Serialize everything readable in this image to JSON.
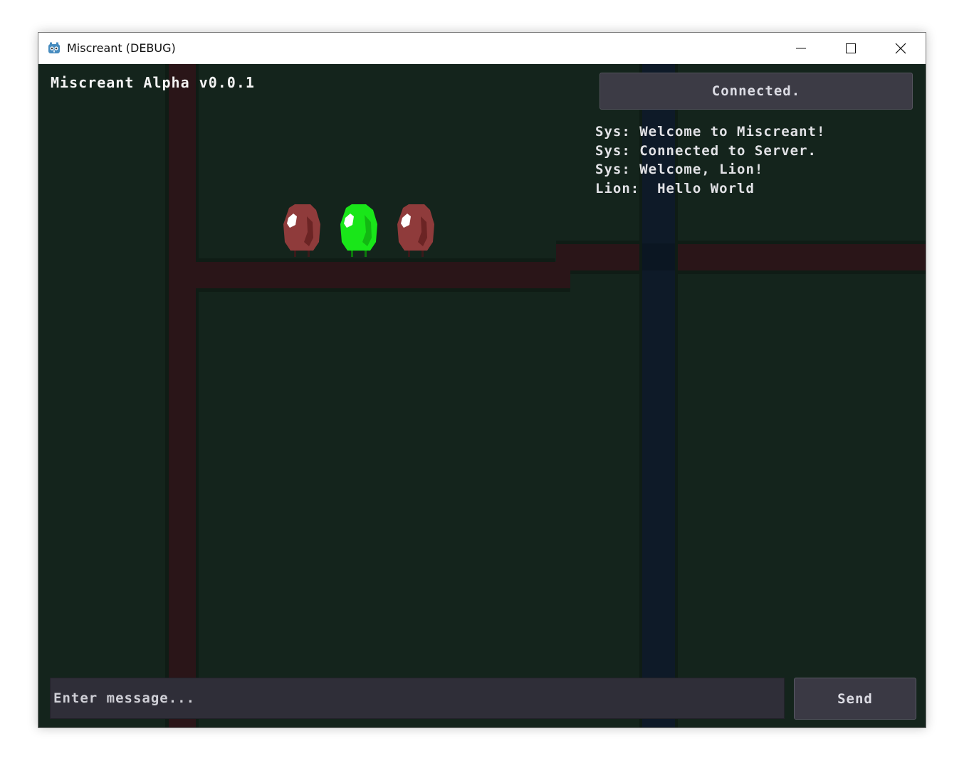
{
  "window": {
    "title": "Miscreant (DEBUG)",
    "app_icon": "godot-icon",
    "controls": {
      "minimize_icon": "minimize-icon",
      "maximize_icon": "maximize-icon",
      "close_icon": "close-icon"
    }
  },
  "hud": {
    "version_label": "Miscreant Alpha v0.0.1",
    "status_button_label": "Connected."
  },
  "chat": {
    "lines": [
      {
        "sender": "Sys:",
        "message": "Welcome to Miscreant!"
      },
      {
        "sender": "Sys:",
        "message": "Connected to Server."
      },
      {
        "sender": "Sys:",
        "message": "Welcome, Lion!"
      },
      {
        "sender": "Lion:",
        "message": " Hello World"
      }
    ],
    "input_placeholder": "Enter message...",
    "input_value": "",
    "send_label": "Send"
  },
  "players": [
    {
      "role": "remote-player",
      "color": "#8f3b3b"
    },
    {
      "role": "local-player",
      "color": "#19e619"
    },
    {
      "role": "remote-player",
      "color": "#8f3b3b"
    }
  ],
  "colors": {
    "background": "#14241c",
    "dirt": "#2a1518",
    "water": "#0e1a28",
    "ui_panel": "#3c3b45"
  }
}
